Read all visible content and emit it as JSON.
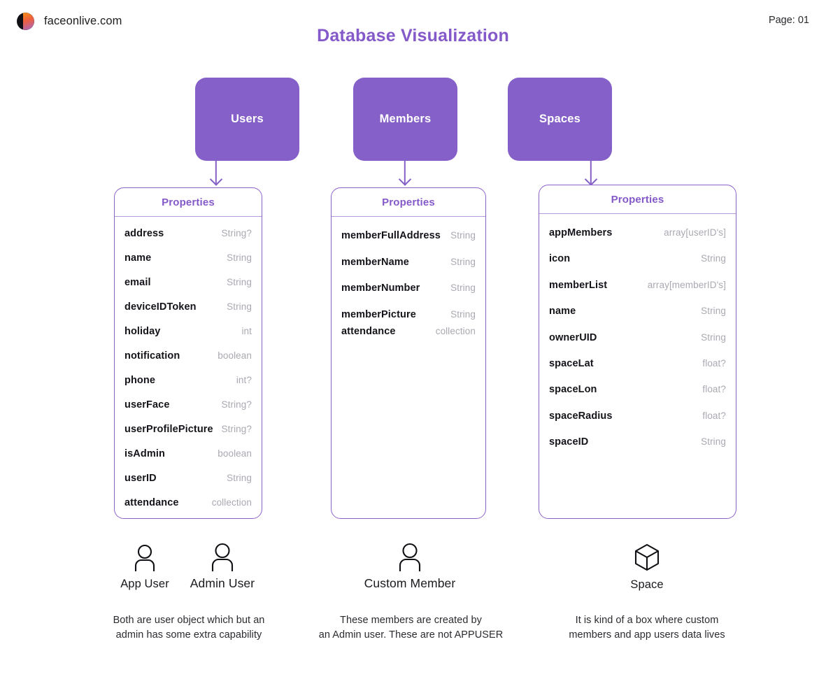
{
  "header": {
    "brand_name": "faceonlive.com",
    "logo_icon": "faceonlive-logo-icon",
    "page_label": "Page: 01",
    "title": "Database Visualization",
    "title_color": "#8459c9"
  },
  "theme": {
    "purple": "#8560c8",
    "purple_text": "#8459c9",
    "card_border": "#8b63cb",
    "type_text": "#a9a9b2"
  },
  "entities": [
    {
      "name": "Users"
    },
    {
      "name": "Members"
    },
    {
      "name": "Spaces"
    }
  ],
  "cards": [
    {
      "title": "Properties",
      "rows": [
        {
          "key": "address",
          "type": "String?"
        },
        {
          "key": "name",
          "type": "String"
        },
        {
          "key": "email",
          "type": "String"
        },
        {
          "key": "deviceIDToken",
          "type": "String"
        },
        {
          "key": "holiday",
          "type": "int"
        },
        {
          "key": "notification",
          "type": "boolean"
        },
        {
          "key": "phone",
          "type": "int?"
        },
        {
          "key": "userFace",
          "type": "String?"
        },
        {
          "key": "userProfilePicture",
          "type": "String?"
        },
        {
          "key": "isAdmin",
          "type": "boolean"
        },
        {
          "key": "userID",
          "type": "String"
        },
        {
          "key": "attendance",
          "type": "collection"
        }
      ]
    },
    {
      "title": "Properties",
      "rows": [
        {
          "key": "memberFullAddress",
          "type": "String"
        },
        {
          "key": "memberName",
          "type": "String"
        },
        {
          "key": "memberNumber",
          "type": "String"
        },
        {
          "key": "memberPicture",
          "type": "String"
        },
        {
          "key": "attendance",
          "type": "collection"
        }
      ]
    },
    {
      "title": "Properties",
      "rows": [
        {
          "key": "appMembers",
          "type": "array[userID's]"
        },
        {
          "key": "icon",
          "type": "String"
        },
        {
          "key": "memberList",
          "type": "array[memberID's]"
        },
        {
          "key": "name",
          "type": "String"
        },
        {
          "key": "ownerUID",
          "type": "String"
        },
        {
          "key": "spaceLat",
          "type": "float?"
        },
        {
          "key": "spaceLon",
          "type": "float?"
        },
        {
          "key": "spaceRadius",
          "type": "float?"
        },
        {
          "key": "spaceID",
          "type": "String"
        }
      ]
    }
  ],
  "legend": [
    {
      "icon": "person-icon",
      "label": "App User"
    },
    {
      "icon": "person-icon",
      "label": "Admin User"
    },
    {
      "icon": "person-icon",
      "label": "Custom Member"
    },
    {
      "icon": "cube-icon",
      "label": "Space"
    }
  ],
  "captions": [
    "Both are user object which but an\nadmin has some extra capability",
    "These members are created by\nan Admin user. These are not APPUSER",
    "It is kind of a box where custom\nmembers and app users data lives"
  ]
}
